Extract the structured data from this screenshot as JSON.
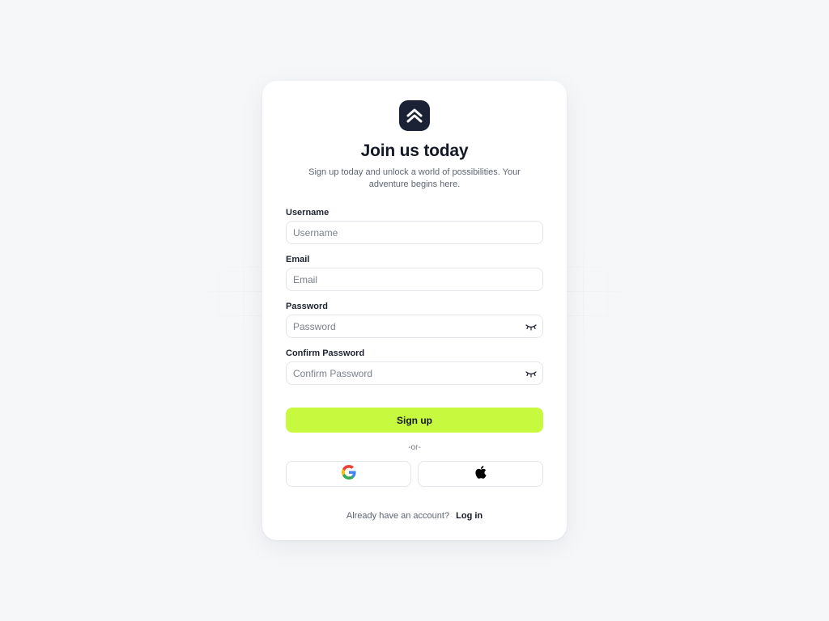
{
  "brand": {
    "logo_icon": "double-chevron-up-icon",
    "logo_bg": "#1b2236"
  },
  "header": {
    "title": "Join us today",
    "subtitle": "Sign up today and unlock a world of possibilities. Your adventure begins here."
  },
  "form": {
    "username": {
      "label": "Username",
      "placeholder": "Username",
      "value": ""
    },
    "email": {
      "label": "Email",
      "placeholder": "Email",
      "value": ""
    },
    "password": {
      "label": "Password",
      "placeholder": "Password",
      "value": "",
      "toggle_icon": "eye-closed-icon"
    },
    "confirm_password": {
      "label": "Confirm Password",
      "placeholder": "Confirm Password",
      "value": "",
      "toggle_icon": "eye-closed-icon"
    },
    "submit_label": "Sign up",
    "submit_color": "#c7fa3f"
  },
  "divider_text": "-or-",
  "social": [
    {
      "provider": "Google",
      "icon": "google-icon"
    },
    {
      "provider": "Apple",
      "icon": "apple-icon"
    }
  ],
  "footer": {
    "prompt": "Already have an account?",
    "link_label": "Log in"
  }
}
